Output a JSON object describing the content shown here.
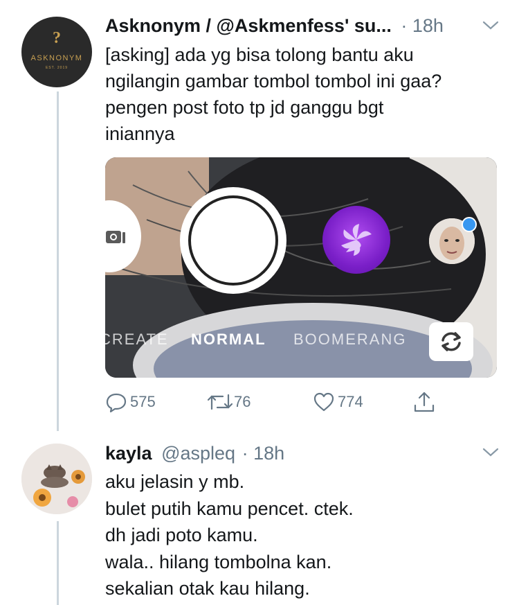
{
  "tweet1": {
    "avatar": {
      "brand": "ASKNONYM",
      "mark": "?",
      "est": "EST. 2019"
    },
    "name": "Asknonym / @Askmenfess' su...",
    "time": "· 18h",
    "lines": [
      "[asking] ada yg bisa tolong bantu aku",
      "ngilangin gambar tombol tombol ini gaa?",
      "pengen post foto tp jd ganggu bgt",
      "iniannya"
    ],
    "media": {
      "modes": {
        "create": "CREATE",
        "normal": "NORMAL",
        "boomerang": "BOOMERANG"
      }
    },
    "actions": {
      "replies": "575",
      "retweets": "76",
      "likes": "774"
    }
  },
  "tweet2": {
    "name": "kayla",
    "handle": "@aspleq",
    "time": "· 18h",
    "lines": [
      "aku jelasin y mb.",
      "bulet putih kamu pencet. ctek.",
      "dh jadi poto kamu.",
      "wala.. hilang tombolna kan.",
      "sekalian otak kau hilang."
    ]
  },
  "colors": {
    "text": "#14171a",
    "muted": "#657786",
    "thread": "#ccd6dd",
    "accent": "#1da1f2",
    "avatarDark": "#2a2a2a",
    "brandGold": "#c8a052"
  }
}
